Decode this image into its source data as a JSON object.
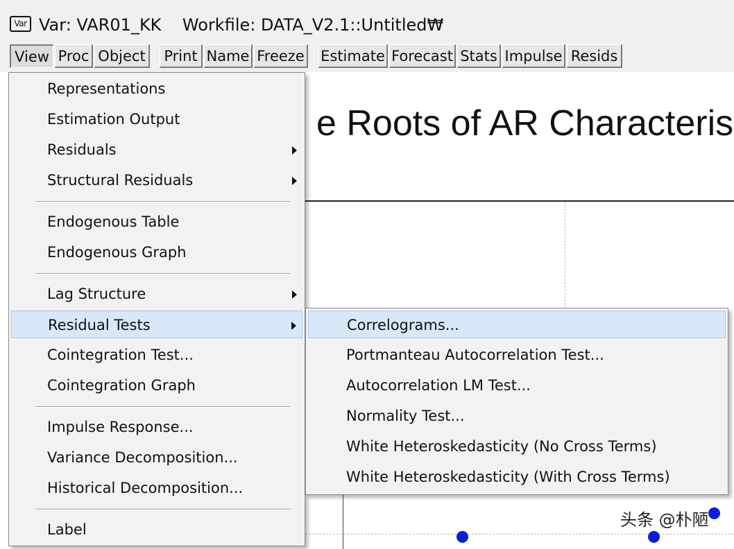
{
  "window": {
    "icon_label": "Var",
    "title": "Var: VAR01_KK    Workfile: DATA_V2.1::Untitled₩"
  },
  "toolbar": {
    "buttons": [
      "View",
      "Proc",
      "Object",
      "Print",
      "Name",
      "Freeze",
      "Estimate",
      "Forecast",
      "Stats",
      "Impulse",
      "Resids"
    ],
    "active": "View"
  },
  "graph": {
    "title_visible": "e Roots of AR Characteristi",
    "root_marker_color": "#0a1fd6"
  },
  "view_menu": {
    "items": [
      {
        "label": "Representations"
      },
      {
        "label": "Estimation Output"
      },
      {
        "label": "Residuals",
        "submenu": true
      },
      {
        "label": "Structural Residuals",
        "submenu": true
      },
      {
        "label": "Endogenous Table"
      },
      {
        "label": "Endogenous Graph"
      },
      {
        "label": "Lag Structure",
        "submenu": true
      },
      {
        "label": "Residual Tests",
        "submenu": true,
        "selected": true
      },
      {
        "label": "Cointegration Test..."
      },
      {
        "label": "Cointegration Graph"
      },
      {
        "label": "Impulse Response..."
      },
      {
        "label": "Variance Decomposition..."
      },
      {
        "label": "Historical Decomposition..."
      },
      {
        "label": "Label"
      }
    ]
  },
  "residual_tests_submenu": {
    "items": [
      {
        "label": "Correlograms...",
        "selected": true
      },
      {
        "label": "Portmanteau Autocorrelation Test..."
      },
      {
        "label": "Autocorrelation LM Test..."
      },
      {
        "label": "Normality Test..."
      },
      {
        "label": "White Heteroskedasticity (No Cross Terms)"
      },
      {
        "label": "White Heteroskedasticity (With Cross Terms)"
      }
    ]
  },
  "colors": {
    "selection_fill": "#d8e8f8",
    "selection_border": "#a6c8ec",
    "menu_bg": "#f2f2f2",
    "toolbar_bg": "#f0f0f0"
  },
  "watermark": "头条 @朴陋"
}
